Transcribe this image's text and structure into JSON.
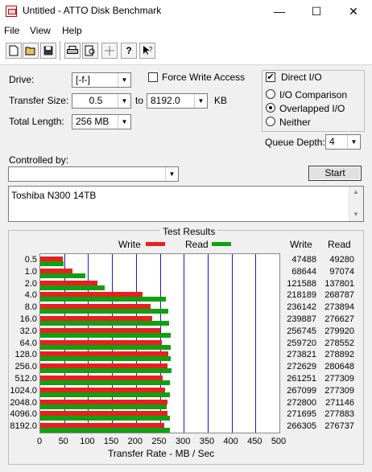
{
  "window": {
    "title": "Untitled - ATTO Disk Benchmark",
    "minimize": "—",
    "maximize": "☐",
    "close": "✕"
  },
  "menu": {
    "file": "File",
    "view": "View",
    "help": "Help"
  },
  "toolbar": {
    "icons": [
      "new-file-icon",
      "open-folder-icon",
      "save-icon",
      "print-icon",
      "print-preview-icon",
      "move-icon",
      "help-icon",
      "context-help-icon"
    ]
  },
  "form": {
    "drive_label": "Drive:",
    "drive_value": "[-f-]",
    "force_write_label": "Force Write Access",
    "transfer_size_label": "Transfer Size:",
    "transfer_from": "0.5",
    "to_label": "to",
    "transfer_to": "8192.0",
    "kb_label": "KB",
    "total_length_label": "Total Length:",
    "total_length_value": "256 MB",
    "direct_io_label": "Direct I/O",
    "direct_io_checked": "✔",
    "io_comparison_label": "I/O Comparison",
    "overlapped_io_label": "Overlapped I/O",
    "neither_label": "Neither",
    "queue_depth_label": "Queue Depth:",
    "queue_depth_value": "4",
    "controlled_by_label": "Controlled by:",
    "controlled_by_value": "",
    "start_label": "Start",
    "description": "Toshiba N300 14TB"
  },
  "results": {
    "title": "Test Results",
    "write_legend": "Write",
    "read_legend": "Read",
    "write_header": "Write",
    "read_header": "Read",
    "xlabel": "Transfer Rate - MB / Sec",
    "write_color": "#e82020",
    "read_color": "#10a010",
    "grid_color": "#1a1ad0"
  },
  "chart_data": {
    "type": "bar",
    "title": "Test Results",
    "xlabel": "Transfer Rate - MB / Sec",
    "xlim": [
      0,
      500
    ],
    "xticks": [
      "0",
      "50",
      "100",
      "150",
      "200",
      "250",
      "300",
      "350",
      "400",
      "450",
      "500"
    ],
    "categories": [
      "0.5",
      "1.0",
      "2.0",
      "4.0",
      "8.0",
      "16.0",
      "32.0",
      "64.0",
      "128.0",
      "256.0",
      "512.0",
      "1024.0",
      "2048.0",
      "4096.0",
      "8192.0"
    ],
    "series": [
      {
        "name": "Write",
        "values": [
          46.3,
          67.0,
          118.7,
          213.1,
          230.7,
          234.3,
          250.7,
          253.6,
          267.4,
          266.2,
          255.1,
          260.8,
          266.4,
          265.3,
          260.1
        ],
        "raw": [
          "47488",
          "68644",
          "121588",
          "218189",
          "236142",
          "239887",
          "256745",
          "259720",
          "273821",
          "272629",
          "261251",
          "267099",
          "272800",
          "271695",
          "266305"
        ]
      },
      {
        "name": "Read",
        "values": [
          48.1,
          94.8,
          134.6,
          262.4,
          267.5,
          270.1,
          273.4,
          272.0,
          272.4,
          274.1,
          270.8,
          270.8,
          265.0,
          271.4,
          270.3
        ],
        "raw": [
          "49280",
          "97074",
          "137801",
          "268787",
          "273894",
          "276627",
          "279920",
          "278552",
          "278892",
          "280648",
          "277309",
          "277309",
          "271146",
          "277883",
          "276737"
        ]
      }
    ]
  }
}
